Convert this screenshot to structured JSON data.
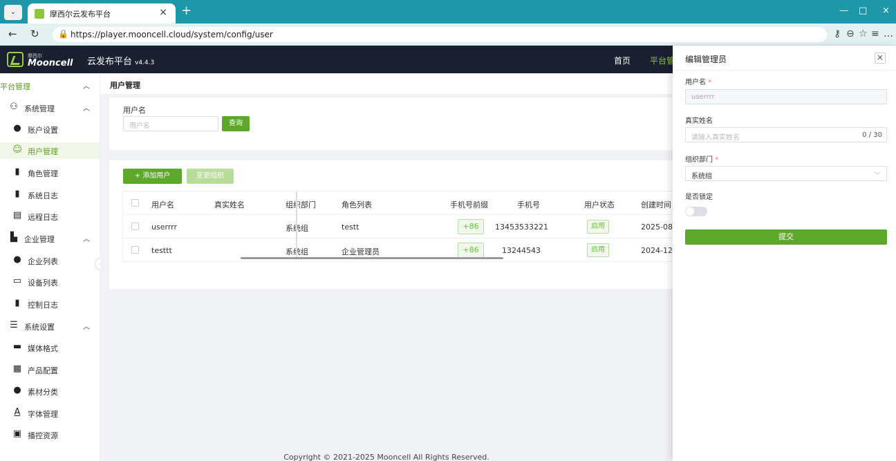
{
  "browser": {
    "tab_title": "摩西尔云发布平台",
    "url": "https://player.mooncell.cloud/system/config/user"
  },
  "header": {
    "logo_cn": "摩西尔",
    "logo_en": "Mooncell",
    "app_title": "云发布平台",
    "version": "v4.4.3",
    "nav": [
      "首页",
      "平台管"
    ]
  },
  "sidebar": {
    "top": "平台管理",
    "items": [
      {
        "label": "系统管理",
        "icon": "users-icon"
      },
      {
        "label": "账户设置",
        "icon": "account-icon"
      },
      {
        "label": "用户管理",
        "icon": "user-group-icon"
      },
      {
        "label": "角色管理",
        "icon": "role-icon"
      },
      {
        "label": "系统日志",
        "icon": "log-icon"
      },
      {
        "label": "远程日志",
        "icon": "remote-log-icon"
      },
      {
        "label": "企业管理",
        "icon": "building-icon"
      },
      {
        "label": "企业列表",
        "icon": "list-icon"
      },
      {
        "label": "设备列表",
        "icon": "monitor-icon"
      },
      {
        "label": "控制日志",
        "icon": "control-log-icon"
      },
      {
        "label": "系统设置",
        "icon": "sliders-icon"
      },
      {
        "label": "媒体格式",
        "icon": "image-icon"
      },
      {
        "label": "产品配置",
        "icon": "grid-icon"
      },
      {
        "label": "素材分类",
        "icon": "category-icon"
      },
      {
        "label": "字体管理",
        "icon": "font-icon"
      },
      {
        "label": "播控资源",
        "icon": "resource-icon"
      }
    ]
  },
  "main": {
    "breadcrumb": "用户管理",
    "filter": {
      "label": "用户名",
      "placeholder": "用户名",
      "query_label": "查询"
    },
    "toolbar": {
      "add_label": "+ 添加用户",
      "change_org_label": "变更组织"
    },
    "table": {
      "columns": [
        "用户名",
        "真实姓名",
        "组织部门",
        "角色列表",
        "手机号前缀",
        "手机号",
        "用户状态",
        "创建时间"
      ],
      "rows": [
        {
          "username": "userrrr",
          "realname": "",
          "dept": "系统组",
          "role": "testt",
          "prefix": "+86",
          "phone": "13453533221",
          "status": "启用",
          "created": "2025-08-"
        },
        {
          "username": "testtt",
          "realname": "",
          "dept": "系统组",
          "role": "企业管理员",
          "prefix": "+86",
          "phone": "13244543",
          "status": "启用",
          "created": "2024-12-"
        }
      ]
    },
    "footer": "Copyright © 2021-2025 Mooncell All Rights Reserved."
  },
  "drawer": {
    "title": "编辑管理员",
    "username_label": "用户名",
    "username_value": "userrrr",
    "realname_label": "真实姓名",
    "realname_placeholder": "请输入真实姓名",
    "realname_count": "0 / 30",
    "dept_label": "组织部门",
    "dept_value": "系统组",
    "locked_label": "是否锁定",
    "submit_label": "提交"
  }
}
